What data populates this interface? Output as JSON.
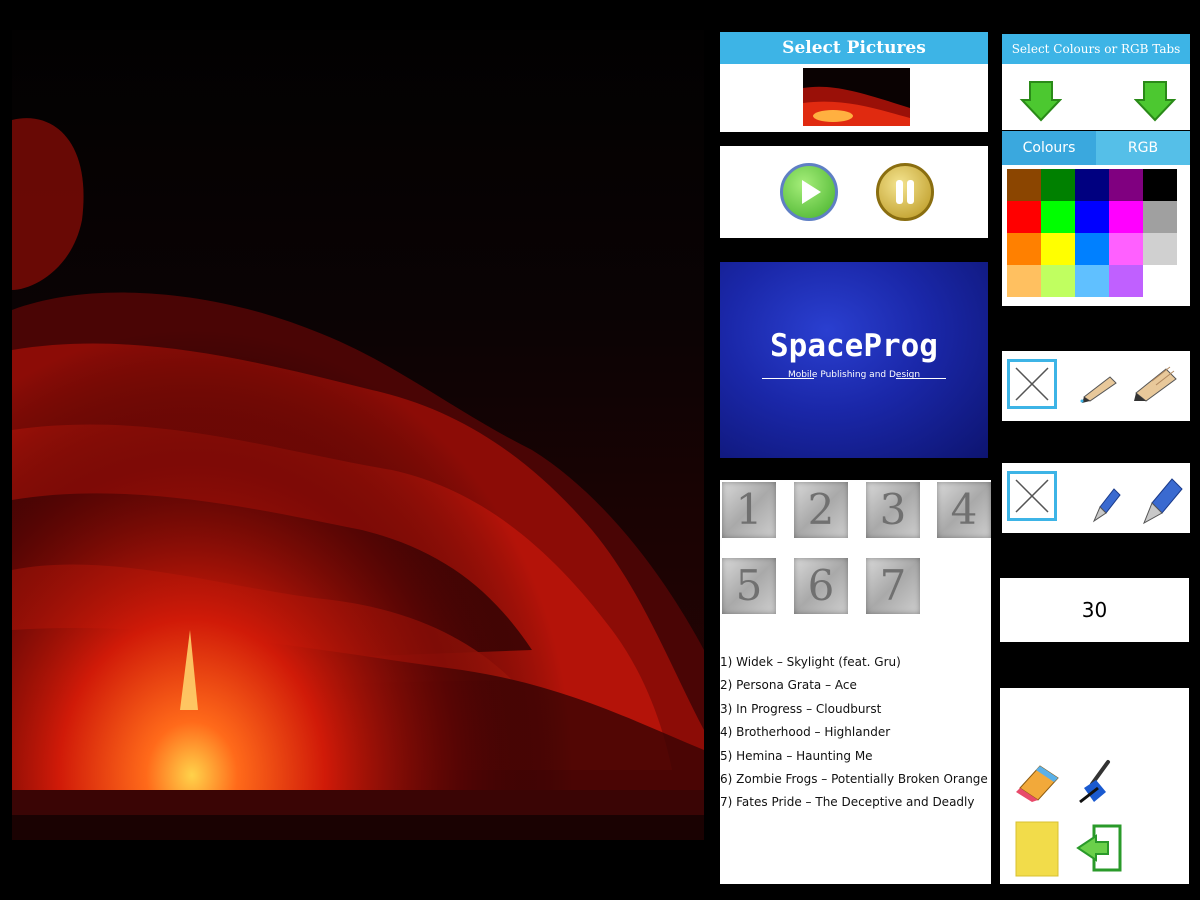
{
  "select_pictures": {
    "title": "Select Pictures"
  },
  "logo": {
    "name": "SpaceProg",
    "tagline": "Mobile Publishing and Design"
  },
  "track_numbers": [
    "1",
    "2",
    "3",
    "4",
    "5",
    "6",
    "7"
  ],
  "tracks": [
    "1) Widek – Skylight (feat. Gru)",
    "2) Persona Grata – Ace",
    "3) In Progress – Cloudburst",
    "4) Brotherhood – Highlander",
    "5) Hemina – Haunting Me",
    "6) Zombie Frogs – Potentially Broken Orange",
    "7) Fates Pride – The Deceptive and Deadly"
  ],
  "colour_selector": {
    "title": "Select Colours or RGB Tabs"
  },
  "tabs": {
    "colours": "Colours",
    "rgb": "RGB"
  },
  "palette": [
    "#8b4500",
    "#008000",
    "#000080",
    "#800080",
    "#000000",
    "#ff0000",
    "#00ff00",
    "#0000ff",
    "#ff00ff",
    "#a0a0a0",
    "#ff8000",
    "#ffff00",
    "#0080ff",
    "#ff60ff",
    "#d0d0d0",
    "#ffc060",
    "#c0ff60",
    "#60c0ff",
    "#c060ff",
    "#ffffff"
  ],
  "brush_size": "30",
  "colors": {
    "accent": "#3db4e6",
    "header_text": "#ffffff"
  }
}
